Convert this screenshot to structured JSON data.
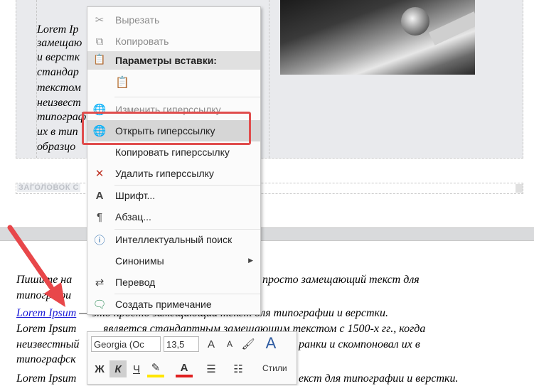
{
  "colors": {
    "link": "#1a1ad6",
    "highlight_box": "#e04d4d",
    "arrow": "#e8474a",
    "font_color_bar": "#e02020",
    "highlight_bar": "#ffe600"
  },
  "page1": {
    "lines": [
      "Lorem Ip",
      "замещаю",
      "и верстк",
      "стандар",
      "текстом",
      "неизвест",
      "типограф",
      "их в тип",
      "образцо"
    ],
    "header_label": "ЗАГОЛОВОК С"
  },
  "page2": {
    "line1": "Пишите на",
    "line1b": "просто замещающий текст для",
    "line2": "типографи",
    "link": "Lorem Ipsum",
    "line3_tail": "— это просто замещающий текст для типографии и верстки.",
    "line4a": "Lorem Ipsum",
    "line4b": "является стандартным замещающим текстом с 1500-х гг., когда",
    "line5a": "неизвестный",
    "line5b": "ранки и скомпоновал их в",
    "line6": "типографск",
    "line7a": "Lorem Ipsum",
    "line7b": "екст для типографии и верстки."
  },
  "context_menu": {
    "cut": "Вырезать",
    "copy": "Копировать",
    "paste_options": "Параметры вставки:",
    "edit_link": "Изменить гиперссылку...",
    "open_link": "Открыть гиперссылку",
    "copy_link": "Копировать гиперссылку",
    "remove_link": "Удалить гиперссылку",
    "font": "Шрифт...",
    "paragraph": "Абзац...",
    "smart_lookup": "Интеллектуальный поиск",
    "synonyms": "Синонимы",
    "translate": "Перевод",
    "new_comment": "Создать примечание"
  },
  "mini_toolbar": {
    "font_name": "Georgia (Oc",
    "font_size": "13,5",
    "bold": "Ж",
    "italic": "К",
    "underline": "Ч",
    "styles": "Стили"
  }
}
